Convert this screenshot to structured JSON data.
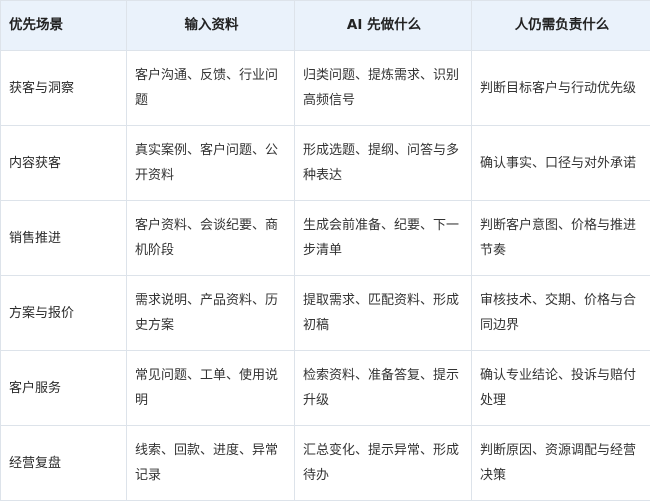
{
  "table": {
    "headers": [
      "优先场景",
      "输入资料",
      "AI 先做什么",
      "人仍需负责什么"
    ],
    "rows": [
      [
        "获客与洞察",
        "客户沟通、反馈、行业问题",
        "归类问题、提炼需求、识别高频信号",
        "判断目标客户与行动优先级"
      ],
      [
        "内容获客",
        "真实案例、客户问题、公开资料",
        "形成选题、提纲、问答与多种表达",
        "确认事实、口径与对外承诺"
      ],
      [
        "销售推进",
        "客户资料、会谈纪要、商机阶段",
        "生成会前准备、纪要、下一步清单",
        "判断客户意图、价格与推进节奏"
      ],
      [
        "方案与报价",
        "需求说明、产品资料、历史方案",
        "提取需求、匹配资料、形成初稿",
        "审核技术、交期、价格与合同边界"
      ],
      [
        "客户服务",
        "常见问题、工单、使用说明",
        "检索资料、准备答复、提示升级",
        "确认专业结论、投诉与赔付处理"
      ],
      [
        "经营复盘",
        "线索、回款、进度、异常记录",
        "汇总变化、提示异常、形成待办",
        "判断原因、资源调配与经营决策"
      ]
    ]
  },
  "colors": {
    "header_background": "#eaf2fb",
    "border": "#dde3ea"
  }
}
